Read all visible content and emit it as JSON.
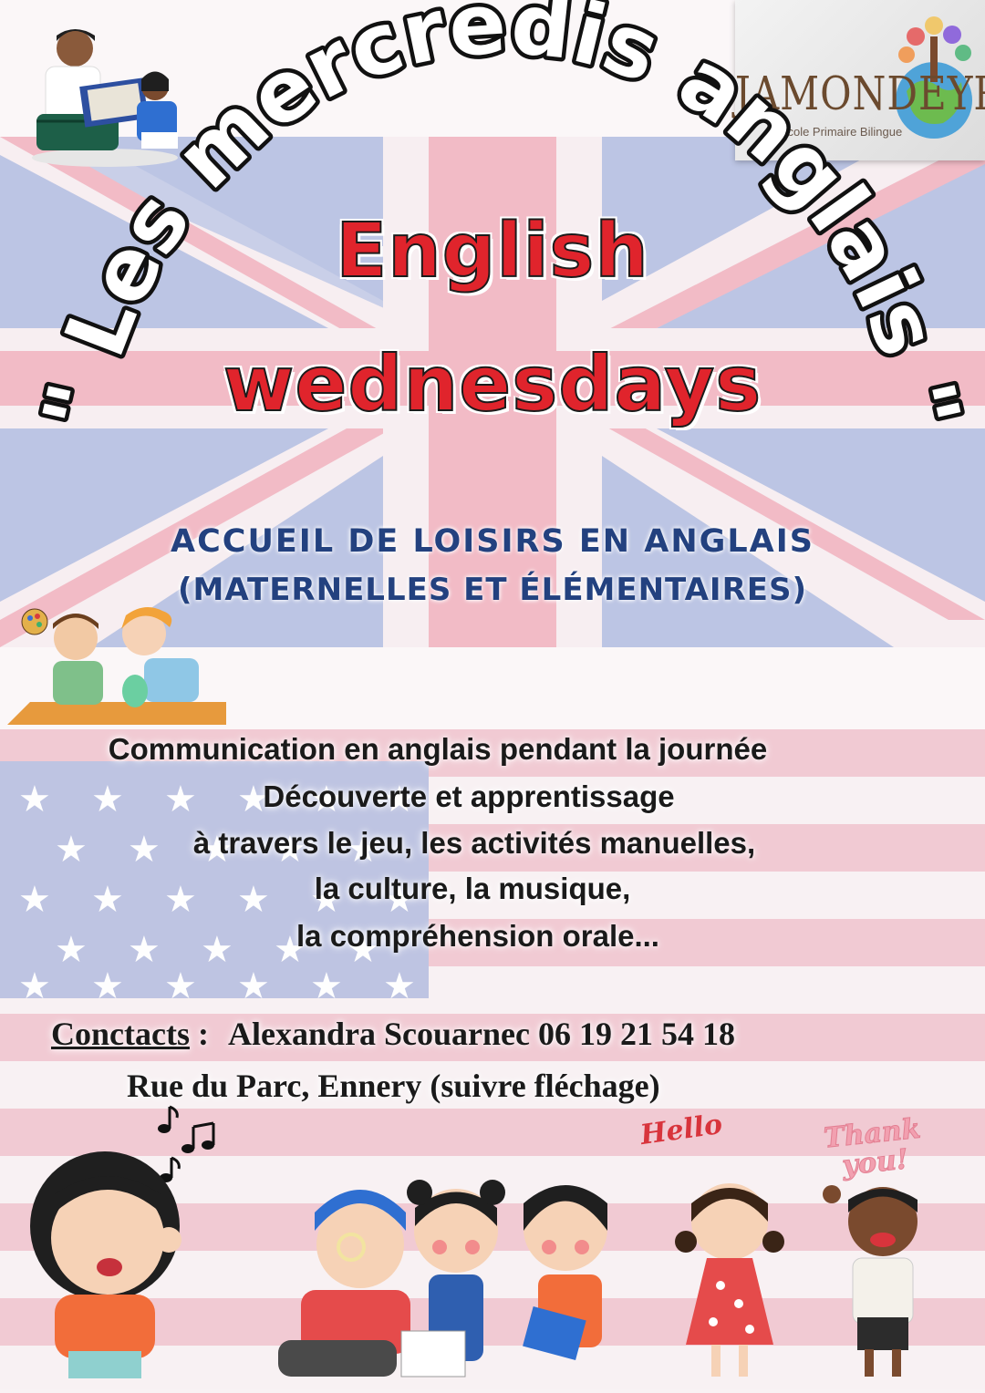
{
  "logo": {
    "name": "JAMONDEYRA",
    "subtitle": "École Primaire Bilingue"
  },
  "arc_title": {
    "text": "\" Les mercredis anglais \""
  },
  "title": {
    "line1": "English",
    "line2": "wednesdays"
  },
  "subtitle": {
    "line1": "ACCUEIL DE LOISIRS EN ANGLAIS",
    "line2": "(MATERNELLES ET ÉLÉMENTAIRES)"
  },
  "description": {
    "line1": "Communication en anglais pendant la journée",
    "line2": "Découverte et apprentissage",
    "line3": "à travers le jeu, les activités manuelles,",
    "line4": "la culture, la musique,",
    "line5": "la compréhension orale..."
  },
  "contact": {
    "label": "Conctacts",
    "separator": ":",
    "person": "Alexandra Scouarnec 06 19 21 54 18",
    "address": "Rue du Parc, Ennery (suivre fléchage)"
  },
  "stickers": {
    "hello": "Hello",
    "thanks_line1": "Thank",
    "thanks_line2": "you!"
  },
  "colors": {
    "title_red": "#e0242c",
    "subtitle_blue": "#23417f",
    "flag_blue": "#b9c3e3",
    "flag_red": "#f2b8c4"
  },
  "icons": {
    "top_left": "parent-reading-book-to-child-illustration",
    "mid_left": "children-doing-crafts-illustration",
    "bottom": "group-of-children-illustration",
    "music": "music-notes-icon"
  }
}
